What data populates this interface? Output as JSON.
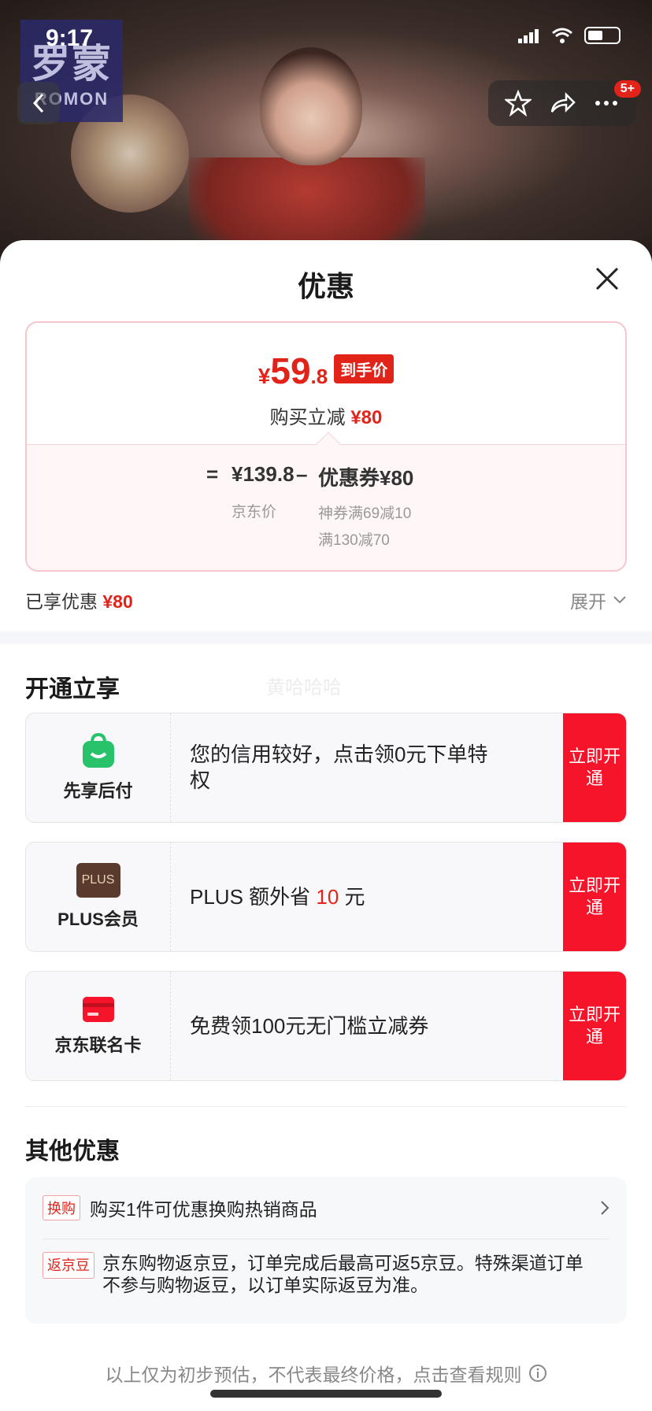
{
  "status_bar": {
    "time": "9:17"
  },
  "brand_logo": {
    "cn": "罗蒙",
    "en": "ROMON"
  },
  "top_actions": {
    "badge": "5+"
  },
  "sheet": {
    "title": "优惠",
    "price": {
      "yen": "¥",
      "int": "59",
      "dec": ".8",
      "tag": "到手价",
      "subtitle_prefix": "购买立减",
      "subtitle_amount": "¥80",
      "equals": "=",
      "jd_price": "¥139.8",
      "jd_price_label": "京东价",
      "minus": "–",
      "coupon": "优惠券¥80",
      "coupon_detail_1": "神券满69减10",
      "coupon_detail_2": "满130减70"
    },
    "enjoyed_label": "已享优惠",
    "enjoyed_amount": "¥80",
    "expand_label": "展开"
  },
  "open_section": {
    "title": "开通立享",
    "watermark": "黄哈哈哈",
    "cards": [
      {
        "label": "先享后付",
        "desc": "您的信用较好，点击领0元下单特权",
        "button": "立即开通"
      },
      {
        "label": "PLUS会员",
        "icon_text": "PLUS",
        "desc_prefix": "PLUS 额外省 ",
        "desc_red": "10",
        "desc_suffix": " 元",
        "button": "立即开通"
      },
      {
        "label": "京东联名卡",
        "desc": "免费领100元无门槛立减券",
        "button": "立即开通"
      }
    ]
  },
  "other_section": {
    "title": "其他优惠",
    "rows": [
      {
        "tag": "换购",
        "text": "购买1件可优惠换购热销商品"
      },
      {
        "tag": "返京豆",
        "text": "京东购物返京豆，订单完成后最高可返5京豆。特殊渠道订单不参与购物返豆，以订单实际返豆为准。"
      }
    ]
  },
  "footer_note": "以上仅为初步预估，不代表最终价格，点击查看规则",
  "colors": {
    "accent": "#e2231a",
    "button_red": "#f5142a",
    "pay_green": "#27c26a",
    "plus_brown": "#5a3a2c"
  }
}
